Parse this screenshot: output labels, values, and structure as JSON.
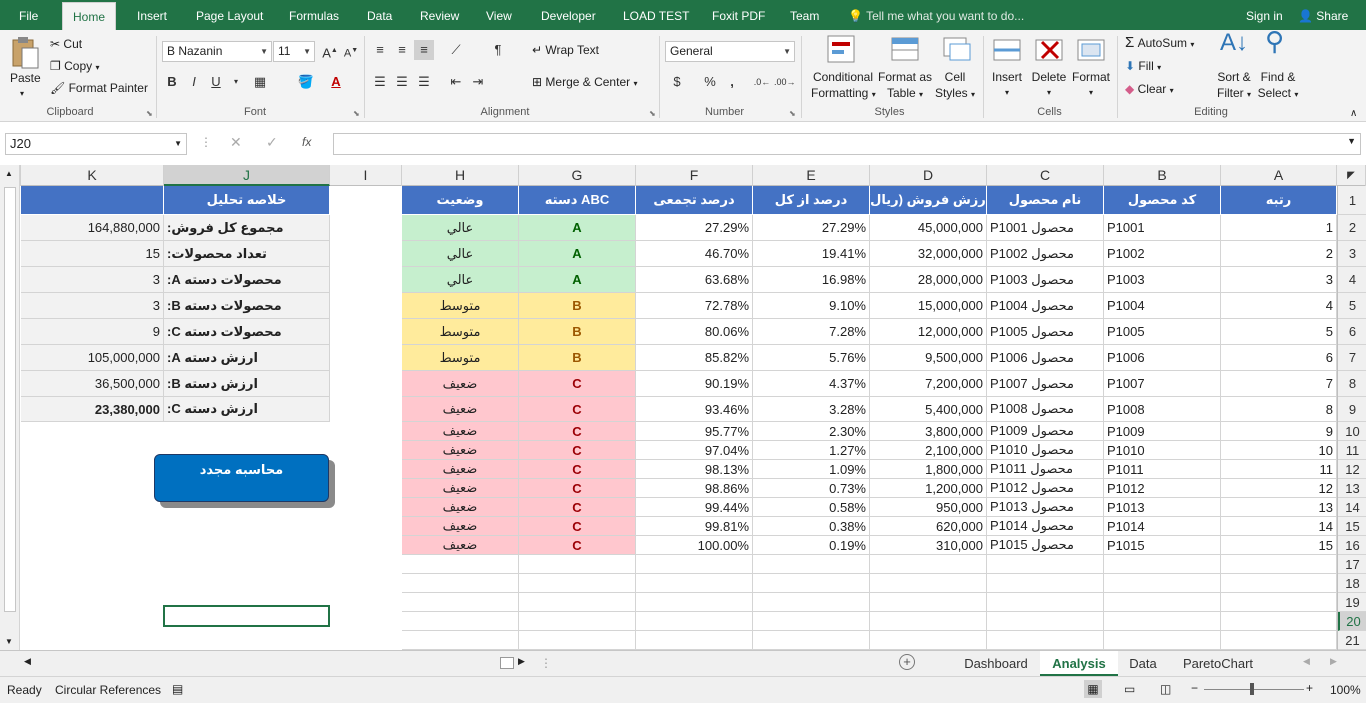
{
  "tabs": [
    "File",
    "Home",
    "Insert",
    "Page Layout",
    "Formulas",
    "Data",
    "Review",
    "View",
    "Developer",
    "LOAD TEST",
    "Foxit PDF",
    "Team"
  ],
  "tell_me": "Tell me what you want to do...",
  "sign_in": "Sign in",
  "share": "Share",
  "clipboard": {
    "paste": "Paste",
    "cut": "Cut",
    "copy": "Copy",
    "format_painter": "Format Painter",
    "label": "Clipboard"
  },
  "font": {
    "name": "B Nazanin",
    "size": "11",
    "label": "Font",
    "bold": "B",
    "italic": "I",
    "underline": "U"
  },
  "alignment": {
    "wrap": "Wrap Text",
    "merge": "Merge & Center",
    "label": "Alignment"
  },
  "number": {
    "format": "General",
    "currency": "$",
    "percent": "%",
    "comma": ",",
    "label": "Number"
  },
  "styles": {
    "cond_1": "Conditional",
    "cond_2": "Formatting",
    "fmt_1": "Format as",
    "fmt_2": "Table",
    "cell_1": "Cell",
    "cell_2": "Styles",
    "label": "Styles"
  },
  "cells": {
    "insert": "Insert",
    "delete": "Delete",
    "format": "Format",
    "label": "Cells"
  },
  "editing": {
    "autosum": "AutoSum",
    "fill": "Fill",
    "clear": "Clear",
    "sort_1": "Sort &",
    "sort_2": "Filter",
    "find_1": "Find &",
    "find_2": "Select",
    "label": "Editing"
  },
  "name_box": "J20",
  "fx": "fx",
  "columns": [
    "K",
    "J",
    "I",
    "H",
    "G",
    "F",
    "E",
    "D",
    "C",
    "B",
    "A"
  ],
  "rows": [
    "1",
    "2",
    "3",
    "4",
    "5",
    "6",
    "7",
    "8",
    "9",
    "10",
    "11",
    "12",
    "13",
    "14",
    "15",
    "16",
    "17",
    "18",
    "19",
    "20",
    "21"
  ],
  "table_headers": [
    "وضعیت",
    "دسته ABC",
    "درصد تجمعی",
    "درصد از کل",
    "ارزش فروش (ریال)",
    "نام محصول",
    "کد محصول",
    "رتبه"
  ],
  "table_rows": [
    {
      "status": "عالي",
      "cls": "A",
      "cum": "27.29%",
      "pct": "27.29%",
      "val": "45,000,000",
      "name": "محصول P1001",
      "code": "P1001",
      "rank": "1"
    },
    {
      "status": "عالي",
      "cls": "A",
      "cum": "46.70%",
      "pct": "19.41%",
      "val": "32,000,000",
      "name": "محصول P1002",
      "code": "P1002",
      "rank": "2"
    },
    {
      "status": "عالي",
      "cls": "A",
      "cum": "63.68%",
      "pct": "16.98%",
      "val": "28,000,000",
      "name": "محصول P1003",
      "code": "P1003",
      "rank": "3"
    },
    {
      "status": "متوسط",
      "cls": "B",
      "cum": "72.78%",
      "pct": "9.10%",
      "val": "15,000,000",
      "name": "محصول P1004",
      "code": "P1004",
      "rank": "4"
    },
    {
      "status": "متوسط",
      "cls": "B",
      "cum": "80.06%",
      "pct": "7.28%",
      "val": "12,000,000",
      "name": "محصول P1005",
      "code": "P1005",
      "rank": "5"
    },
    {
      "status": "متوسط",
      "cls": "B",
      "cum": "85.82%",
      "pct": "5.76%",
      "val": "9,500,000",
      "name": "محصول P1006",
      "code": "P1006",
      "rank": "6"
    },
    {
      "status": "ضعيف",
      "cls": "C",
      "cum": "90.19%",
      "pct": "4.37%",
      "val": "7,200,000",
      "name": "محصول P1007",
      "code": "P1007",
      "rank": "7"
    },
    {
      "status": "ضعيف",
      "cls": "C",
      "cum": "93.46%",
      "pct": "3.28%",
      "val": "5,400,000",
      "name": "محصول P1008",
      "code": "P1008",
      "rank": "8"
    },
    {
      "status": "ضعيف",
      "cls": "C",
      "cum": "95.77%",
      "pct": "2.30%",
      "val": "3,800,000",
      "name": "محصول P1009",
      "code": "P1009",
      "rank": "9"
    },
    {
      "status": "ضعيف",
      "cls": "C",
      "cum": "97.04%",
      "pct": "1.27%",
      "val": "2,100,000",
      "name": "محصول P1010",
      "code": "P1010",
      "rank": "10"
    },
    {
      "status": "ضعيف",
      "cls": "C",
      "cum": "98.13%",
      "pct": "1.09%",
      "val": "1,800,000",
      "name": "محصول P1011",
      "code": "P1011",
      "rank": "11"
    },
    {
      "status": "ضعيف",
      "cls": "C",
      "cum": "98.86%",
      "pct": "0.73%",
      "val": "1,200,000",
      "name": "محصول P1012",
      "code": "P1012",
      "rank": "12"
    },
    {
      "status": "ضعيف",
      "cls": "C",
      "cum": "99.44%",
      "pct": "0.58%",
      "val": "950,000",
      "name": "محصول P1013",
      "code": "P1013",
      "rank": "13"
    },
    {
      "status": "ضعيف",
      "cls": "C",
      "cum": "99.81%",
      "pct": "0.38%",
      "val": "620,000",
      "name": "محصول P1014",
      "code": "P1014",
      "rank": "14"
    },
    {
      "status": "ضعيف",
      "cls": "C",
      "cum": "100.00%",
      "pct": "0.19%",
      "val": "310,000",
      "name": "محصول P1015",
      "code": "P1015",
      "rank": "15"
    }
  ],
  "summary": {
    "header": "خلاصه تحلیل",
    "items": [
      {
        "label": "مجموع کل فروش:",
        "value": "164,880,000"
      },
      {
        "label": "تعداد محصولات:",
        "value": "15"
      },
      {
        "label": "محصولات دسته A:",
        "value": "3"
      },
      {
        "label": "محصولات دسته B:",
        "value": "3"
      },
      {
        "label": "محصولات دسته C:",
        "value": "9"
      },
      {
        "label": "ارزش دسته A:",
        "value": "105,000,000"
      },
      {
        "label": "ارزش دسته B:",
        "value": "36,500,000"
      },
      {
        "label": "ارزش دسته C:",
        "value": "23,380,000"
      }
    ]
  },
  "recalc_button": "محاسبه مجدد",
  "sheet_tabs": [
    "Dashboard",
    "Analysis",
    "Data",
    "ParetoChart"
  ],
  "active_sheet": "Analysis",
  "status": {
    "ready": "Ready",
    "circular": "Circular References",
    "zoom": "100%"
  }
}
